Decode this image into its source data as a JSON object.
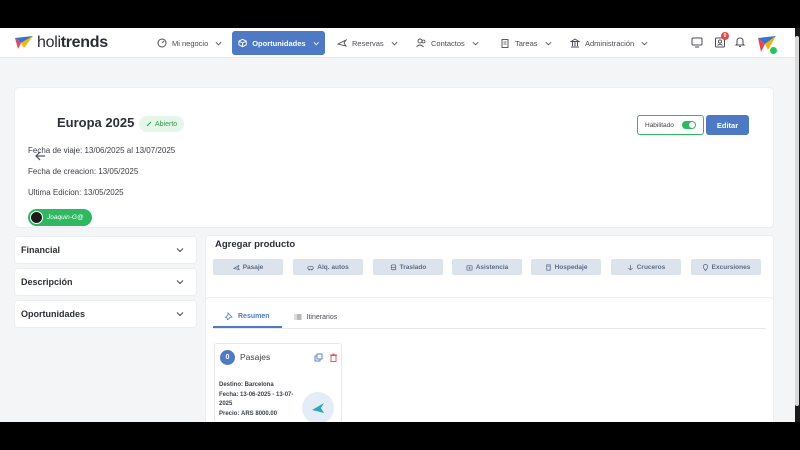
{
  "nav": {
    "logo": {
      "part1": "holi",
      "part2": "trends"
    },
    "items": [
      {
        "label": "Mi negocio",
        "icon": "gauge-icon"
      },
      {
        "label": "Oportunidades",
        "icon": "cube-icon",
        "active": true
      },
      {
        "label": "Reservas",
        "icon": "plane-icon"
      },
      {
        "label": "Contactos",
        "icon": "users-icon"
      },
      {
        "label": "Tareas",
        "icon": "clipboard-icon"
      },
      {
        "label": "Administración",
        "icon": "bank-icon"
      }
    ],
    "notification_count": "0"
  },
  "header": {
    "title": "Europa 2025",
    "status": "Abierto",
    "fecha_viaje": "Fecha de viaje: 13/06/2025 al 13/07/2025",
    "fecha_creacion": "Fecha de creacion: 13/05/2025",
    "ultima_edicion": "Ultima Edicion: 13/05/2025",
    "user": "Joaquin-G@",
    "toggle_label": "Habilitado",
    "edit_label": "Editar"
  },
  "sidebar": {
    "sections": [
      "Financial",
      "Descripción",
      "Oportunidades"
    ]
  },
  "products": {
    "title": "Agregar producto",
    "buttons": [
      "Pasaje",
      "Alq. autos",
      "Traslado",
      "Asistencia",
      "Hospedaje",
      "Cruceros",
      "Excursiones"
    ]
  },
  "summary": {
    "tabs": [
      "Resumen",
      "Itinerarios"
    ],
    "card": {
      "count": "0",
      "title": "Pasajes",
      "destino_label": "Destino:",
      "destino": "Barcelona",
      "fecha_label": "Fecha:",
      "fecha_line1": "13-06-2025 - 13-07-",
      "fecha_line2": "2025",
      "precio_label": "Precio:",
      "precio": "ARS 8000.00"
    }
  },
  "colors": {
    "accent": "#4e79c4",
    "success": "#2fb861",
    "danger": "#e5484d"
  }
}
